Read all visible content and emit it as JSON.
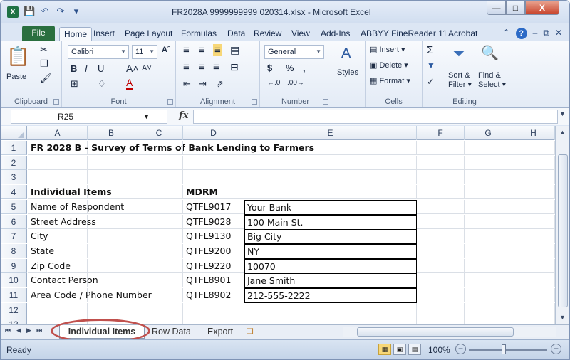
{
  "window": {
    "title": "FR2028A 9999999999 020314.xlsx - Microsoft Excel",
    "app_icon": "X"
  },
  "ribbon_tabs": [
    "File",
    "Home",
    "Insert",
    "Page Layout",
    "Formulas",
    "Data",
    "Review",
    "View",
    "Add-Ins",
    "ABBYY FineReader 11",
    "Acrobat"
  ],
  "ribbon": {
    "clipboard": {
      "label": "Clipboard",
      "paste": "Paste"
    },
    "font": {
      "label": "Font",
      "name": "Calibri",
      "size": "11"
    },
    "alignment": {
      "label": "Alignment"
    },
    "number": {
      "label": "Number",
      "format": "General",
      "currency": "$",
      "percent": "%",
      "comma": ","
    },
    "styles": {
      "label": "Styles"
    },
    "cells": {
      "label": "Cells",
      "insert": "Insert",
      "delete": "Delete",
      "format": "Format"
    },
    "editing": {
      "label": "Editing",
      "sort": "Sort &",
      "filter": "Filter",
      "find": "Find &",
      "select": "Select"
    }
  },
  "formula_bar": {
    "name_box": "R25",
    "fx": "fx",
    "content": ""
  },
  "columns": [
    "A",
    "B",
    "C",
    "D",
    "E",
    "F",
    "G",
    "H"
  ],
  "rows": [
    {
      "num": "1",
      "a": "FR 2028 B - Survey of Terms of Bank Lending to Farmers",
      "d": "",
      "e": "",
      "bold": true
    },
    {
      "num": "2",
      "a": "",
      "d": "",
      "e": ""
    },
    {
      "num": "3",
      "a": "",
      "d": "",
      "e": ""
    },
    {
      "num": "4",
      "a": "Individual Items",
      "d": "MDRM",
      "e": "",
      "bold": true
    },
    {
      "num": "5",
      "a": "Name of Respondent",
      "d": "QTFL9017",
      "e": "Your Bank"
    },
    {
      "num": "6",
      "a": "Street Address",
      "d": "QTFL9028",
      "e": "100 Main St."
    },
    {
      "num": "7",
      "a": "City",
      "d": "QTFL9130",
      "e": "Big City"
    },
    {
      "num": "8",
      "a": "State",
      "d": "QTFL9200",
      "e": "NY"
    },
    {
      "num": "9",
      "a": "Zip Code",
      "d": "QTFL9220",
      "e": "10070"
    },
    {
      "num": "10",
      "a": "Contact Person",
      "d": "QTFL8901",
      "e": "Jane Smith"
    },
    {
      "num": "11",
      "a": "Area Code / Phone Number",
      "d": "QTFL8902",
      "e": "212-555-2222"
    },
    {
      "num": "12",
      "a": "",
      "d": "",
      "e": ""
    },
    {
      "num": "13",
      "a": "",
      "d": "",
      "e": ""
    }
  ],
  "sheet_tabs": [
    "Individual Items",
    "Row Data",
    "Export"
  ],
  "status": {
    "ready": "Ready",
    "zoom": "100%"
  }
}
